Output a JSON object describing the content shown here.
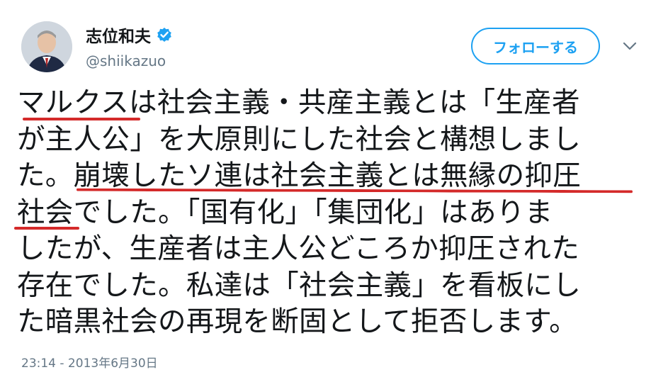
{
  "tweet": {
    "author_name": "志位和夫",
    "author_handle": "@shiikazuo",
    "follow_label": "フォローする",
    "text_lines": [
      "マルクスは社会主義・共産主義とは「生産者",
      "が主人公」を大原則にした社会と構想しまし",
      "た。崩壊したソ連は社会主義とは無縁の抑圧",
      "社会でした。「国有化」「集団化」はありま",
      "したが、生産者は主人公どころか抑圧された",
      "存在でした。私達は「社会主義」を看板にし",
      "た暗黒社会の再現を断固として拒否します。"
    ],
    "timestamp": "23:14 - 2013年6月30日"
  },
  "icons": {
    "verified": "verified-badge-icon",
    "caret": "chevron-down-icon",
    "avatar": "profile-photo"
  },
  "colors": {
    "accent": "#1da1f2",
    "text": "#14171a",
    "secondary": "#657786",
    "underline": "#d42a2a"
  }
}
